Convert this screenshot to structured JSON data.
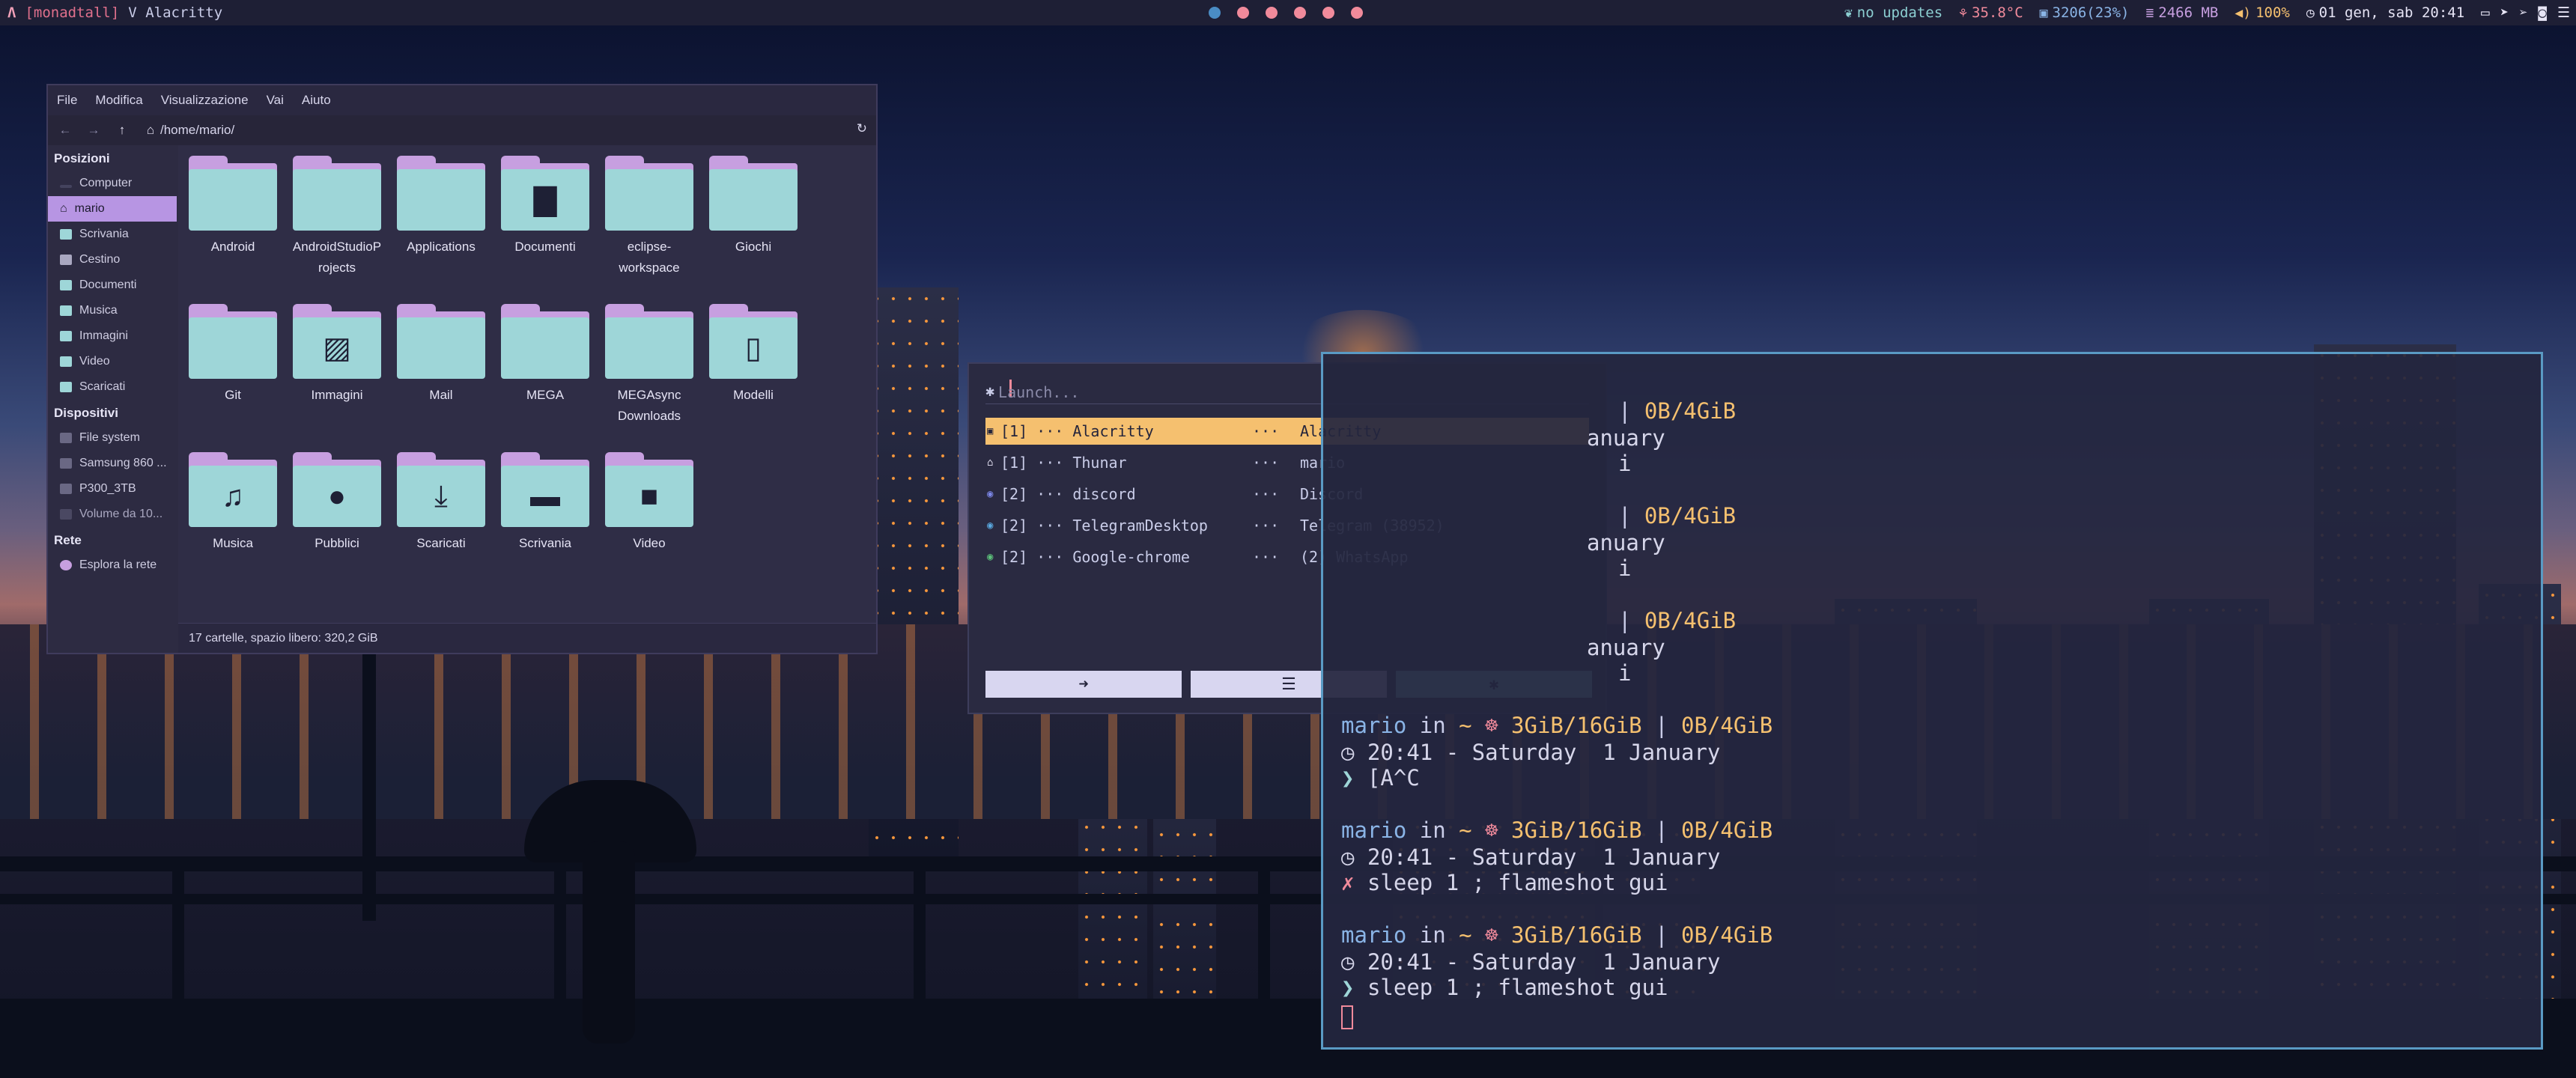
{
  "topbar": {
    "layout": "[monadtall]",
    "window_title": "Alacritty",
    "updates": "no updates",
    "temp": "35.8°C",
    "cpu": "3206(23%)",
    "mem": "2466 MB",
    "volume": "100%",
    "clock": "01 gen, sab 20:41"
  },
  "thunar": {
    "menu": [
      "File",
      "Modifica",
      "Visualizzazione",
      "Vai",
      "Aiuto"
    ],
    "path": "/home/mario/",
    "sidebar": {
      "places_header": "Posizioni",
      "places": [
        "Computer",
        "mario",
        "Scrivania",
        "Cestino",
        "Documenti",
        "Musica",
        "Immagini",
        "Video",
        "Scaricati"
      ],
      "devices_header": "Dispositivi",
      "devices": [
        "File system",
        "Samsung 860 ...",
        "P300_3TB",
        "Volume da 10..."
      ],
      "network_header": "Rete",
      "network": [
        "Esplora la rete"
      ]
    },
    "files": [
      {
        "name": "Android",
        "icon": ""
      },
      {
        "name": "AndroidStudioP\nrojects",
        "icon": ""
      },
      {
        "name": "Applications",
        "icon": ""
      },
      {
        "name": "Documenti",
        "icon": "document-icon"
      },
      {
        "name": "eclipse-\nworkspace",
        "icon": ""
      },
      {
        "name": "Giochi",
        "icon": ""
      },
      {
        "name": "Git",
        "icon": ""
      },
      {
        "name": "Immagini",
        "icon": "image-icon"
      },
      {
        "name": "Mail",
        "icon": ""
      },
      {
        "name": "MEGA",
        "icon": ""
      },
      {
        "name": "MEGAsync\nDownloads",
        "icon": ""
      },
      {
        "name": "Modelli",
        "icon": "template-icon"
      },
      {
        "name": "Musica",
        "icon": "music-icon"
      },
      {
        "name": "Pubblici",
        "icon": "user-icon"
      },
      {
        "name": "Scaricati",
        "icon": "download-icon"
      },
      {
        "name": "Scrivania",
        "icon": "desktop-icon"
      },
      {
        "name": "Video",
        "icon": "video-icon"
      }
    ],
    "status": "17 cartelle, spazio libero: 320,2 GiB"
  },
  "rofi": {
    "prompt_icon": "✱",
    "placeholder": "Launch...",
    "rows": [
      {
        "ws": "[1]",
        "cls": "Alacritty",
        "title": "Alacritty"
      },
      {
        "ws": "[1]",
        "cls": "Thunar",
        "title": "mario"
      },
      {
        "ws": "[2]",
        "cls": "discord",
        "title": "Discord"
      },
      {
        "ws": "[2]",
        "cls": "TelegramDesktop",
        "title": "Telegram (38952)"
      },
      {
        "ws": "[2]",
        "cls": "Google-chrome",
        "title": "(2) WhatsApp"
      }
    ],
    "sep": "···"
  },
  "terminal": {
    "mem": "3GiB/16GiB",
    "swap": "0B/4GiB",
    "time": "20:41",
    "date": "Saturday  1 January",
    "user": "mario",
    "cmd1": "[A^C",
    "cmd2": "sleep 1 ; flameshot gui",
    "cmd3": "sleep 1 ; flameshot gui"
  }
}
